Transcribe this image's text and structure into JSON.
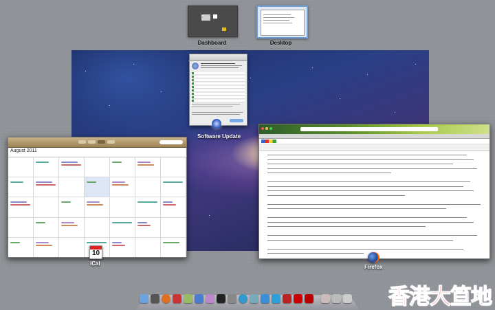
{
  "spaces": {
    "dashboard_label": "Dashboard",
    "desktop_label": "Desktop"
  },
  "windows": {
    "software_update": {
      "label": "Software Update"
    },
    "ical": {
      "label": "iCal",
      "month": "August 2011",
      "dock_date": "10",
      "dock_month": "JUL"
    },
    "firefox": {
      "label": "Firefox"
    }
  },
  "dock": {
    "icons": [
      "finder-icon",
      "dashboard-icon",
      "firefox-icon",
      "ical-icon",
      "iphoto-icon",
      "itunes-icon",
      "preview-icon",
      "terminal-icon",
      "system-preferences-icon",
      "safari-icon",
      "mail-icon",
      "app-store-icon",
      "skype-icon",
      "photo-booth-icon",
      "flash-icon",
      "acrobat-icon",
      "documents-folder-icon",
      "downloads-folder-icon",
      "trash-icon"
    ]
  },
  "watermark": "香港大笪地",
  "colors": {
    "accent_red": "#e60012",
    "update_green": "#2a9d3a"
  }
}
